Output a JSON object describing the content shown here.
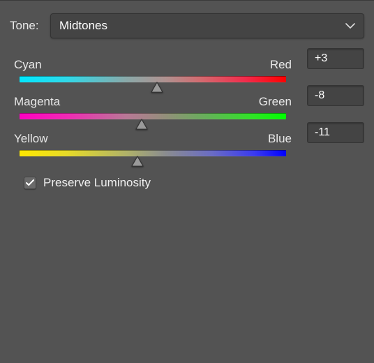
{
  "tone": {
    "label": "Tone:",
    "selected": "Midtones"
  },
  "sliders": [
    {
      "left_label": "Cyan",
      "right_label": "Red",
      "value": "+3",
      "thumb_percent": 51.5,
      "gradient": "grad-cyan-red"
    },
    {
      "left_label": "Magenta",
      "right_label": "Green",
      "value": "-8",
      "thumb_percent": 46,
      "gradient": "grad-magenta-green"
    },
    {
      "left_label": "Yellow",
      "right_label": "Blue",
      "value": "-11",
      "thumb_percent": 44.5,
      "gradient": "grad-yellow-blue"
    }
  ],
  "preserve_luminosity": {
    "label": "Preserve Luminosity",
    "checked": true
  }
}
